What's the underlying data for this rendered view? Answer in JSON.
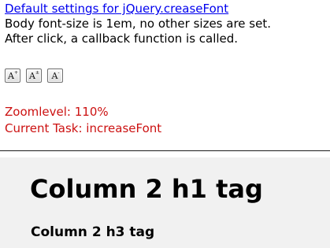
{
  "header": {
    "link_text": "Default settings for jQuery.creaseFont",
    "description_line1": "Body font-size is 1em, no other sizes are set.",
    "description_line2": "After click, a callback function is called."
  },
  "font_buttons": [
    {
      "glyph": "A",
      "mark": "+",
      "name": "increase"
    },
    {
      "glyph": "A",
      "mark": "±",
      "name": "reset"
    },
    {
      "glyph": "A",
      "mark": "-",
      "name": "decrease"
    }
  ],
  "status": {
    "zoom_label": "Zoomlevel: 110%",
    "task_label": "Current Task: increaseFont"
  },
  "column2": {
    "h1": "Column 2 h1 tag",
    "h3": "Column 2 h3 tag"
  },
  "colors": {
    "link": "#0000ee",
    "status": "#cc1111",
    "column_bg": "#f1f1f1"
  }
}
